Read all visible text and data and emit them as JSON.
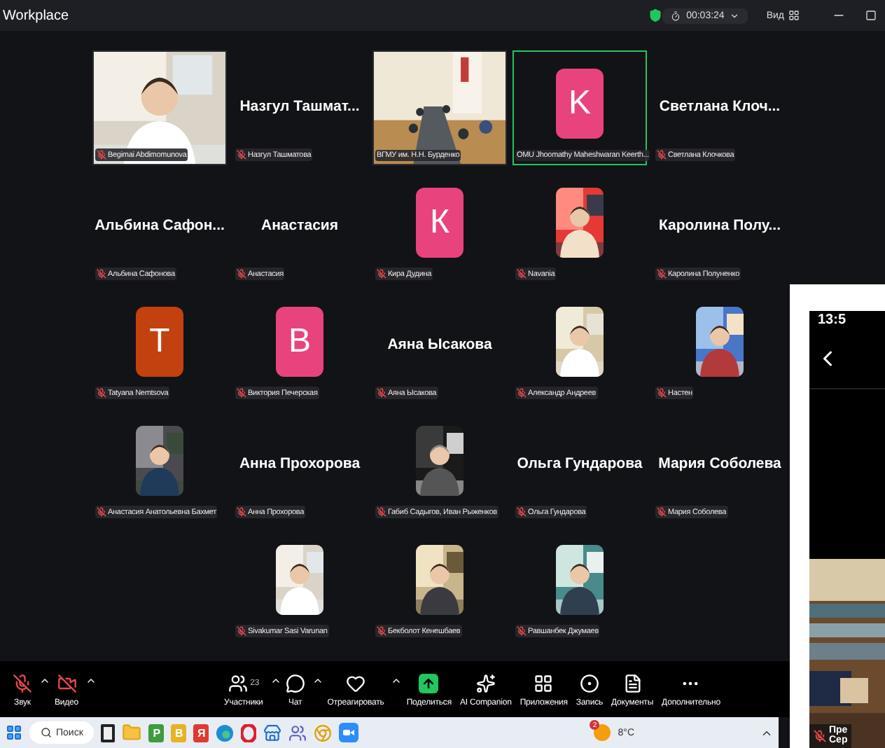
{
  "window": {
    "title": "Workplace",
    "timer": "00:03:24",
    "view": "Вид"
  },
  "rows": [
    [
      {
        "kind": "video",
        "tag": "Begimai Abdimomunova",
        "muted": true,
        "highlighted": false
      },
      {
        "kind": "name",
        "name": "Назгул  Ташмат...",
        "tag": "Назгул Ташматова",
        "muted": true,
        "highlighted": false
      },
      {
        "kind": "video",
        "tag": "ВГМУ им. Н.Н. Бурденко",
        "muted": false,
        "highlighted": false
      },
      {
        "kind": "letter",
        "letter": "K",
        "color": "#e8437c",
        "tag": "OMU Jhoomathy Maheshwaran Keerth...",
        "muted": false,
        "highlighted": true
      },
      {
        "kind": "name",
        "name": "Светлана  Клоч...",
        "tag": "Светлана Клочкова",
        "muted": true,
        "highlighted": false
      }
    ],
    [
      {
        "kind": "name",
        "name": "Альбина  Сафон...",
        "tag": "Альбина Сафонова",
        "muted": true,
        "highlighted": false
      },
      {
        "kind": "name",
        "name": "Анастасия",
        "tag": "Анастасия",
        "muted": true,
        "highlighted": false
      },
      {
        "kind": "letter",
        "letter": "К",
        "color": "#e8437c",
        "tag": "Кира Дудина",
        "muted": true,
        "highlighted": false
      },
      {
        "tag": "Navania",
        "muted": true,
        "highlighted": false
      },
      {
        "kind": "name",
        "name": "Каролина  Полу...",
        "tag": "Каролина Полуненко",
        "muted": true,
        "highlighted": false
      }
    ],
    [
      {
        "kind": "letter",
        "letter": "T",
        "color": "#c2410f",
        "tag": "Tatyana Nemtsova",
        "muted": true,
        "highlighted": false
      },
      {
        "kind": "letter",
        "letter": "В",
        "color": "#e8437c",
        "tag": "Виктория Печерская",
        "muted": true,
        "highlighted": false
      },
      {
        "kind": "name",
        "name": "Аяна Ысакова",
        "tag": "Аяна Ысакова",
        "muted": true,
        "highlighted": false
      },
      {
        "tag": "Александр Андреев",
        "muted": true,
        "highlighted": false
      },
      {
        "tag": "Настен",
        "muted": true,
        "highlighted": false
      }
    ],
    [
      {
        "tag": "Анастасия Анатольевна Бахмет",
        "muted": true,
        "highlighted": false
      },
      {
        "kind": "name",
        "name": "Анна Прохорова",
        "tag": "Анна Прохорова",
        "muted": true,
        "highlighted": false
      },
      {
        "tag": "Габиб Садыгов, Иван Рыженков",
        "muted": true,
        "highlighted": false
      },
      {
        "kind": "name",
        "name": "Ольга Гундарова",
        "tag": "Ольга Гундарова",
        "muted": true,
        "highlighted": false
      },
      {
        "kind": "name",
        "name": "Мария Соболева",
        "tag": "Мария Соболева",
        "muted": true,
        "highlighted": false
      }
    ],
    [
      {
        "tag": "Sivakumar Sasi Varunan",
        "muted": true,
        "highlighted": false
      },
      {
        "tag": "Бекболот Кенешбаев",
        "muted": true,
        "highlighted": false
      },
      {
        "tag": "Равшанбек Джумаев",
        "muted": true,
        "highlighted": false
      }
    ]
  ],
  "toolbar": {
    "left": [
      {
        "kind": "audio",
        "label": "Звук",
        "off": true
      },
      {
        "kind": "video",
        "label": "Видео",
        "off": true
      }
    ],
    "center": [
      {
        "kind": "participants",
        "label": "Участники",
        "count": "23",
        "caret": true
      },
      {
        "kind": "chat",
        "label": "Чат",
        "caret": true
      },
      {
        "kind": "react",
        "label": "Отреагировать",
        "caret": true
      },
      {
        "kind": "share",
        "label": "Поделиться",
        "caret": false
      },
      {
        "kind": "ai",
        "label": "AI Companion",
        "caret": false
      },
      {
        "kind": "apps",
        "label": "Приложения",
        "caret": false
      },
      {
        "kind": "record",
        "label": "Запись",
        "caret": false
      },
      {
        "kind": "docs",
        "label": "Документы",
        "caret": false
      },
      {
        "kind": "more",
        "label": "Дополнительно",
        "caret": false
      }
    ]
  },
  "taskbar": {
    "search": "Поиск",
    "apps": [
      {
        "kind": "files"
      },
      {
        "kind": "folder"
      },
      {
        "kind": "letter",
        "label": "P",
        "color": "#3f9b3f"
      },
      {
        "kind": "letter",
        "label": "B",
        "color": "#e6b422"
      },
      {
        "kind": "letter",
        "label": "Я",
        "color": "#e03a2f"
      },
      {
        "kind": "edge"
      },
      {
        "kind": "opera"
      },
      {
        "kind": "store"
      },
      {
        "kind": "teams"
      },
      {
        "kind": "chrome"
      },
      {
        "kind": "zoom"
      }
    ],
    "weather": "8°C",
    "weather_badge": "2"
  },
  "phone": {
    "time": "13:5",
    "tag_lines": [
      "Пре",
      "Сер"
    ]
  }
}
